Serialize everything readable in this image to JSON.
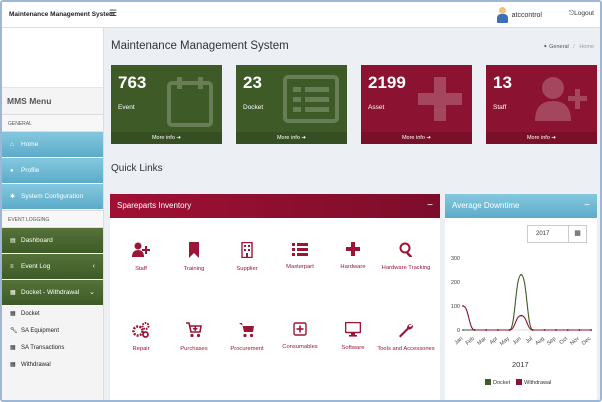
{
  "app": {
    "brand": "Maintenance Management System",
    "user": "atccontrol",
    "logout": "Logout"
  },
  "page": {
    "title": "Maintenance Management System",
    "breadcrumb": [
      "General",
      "Home"
    ]
  },
  "sidebar": {
    "menu_title": "MMS Menu",
    "section_general": "GENERAL",
    "section_event": "EVENT LOGGING",
    "items": [
      {
        "label": "Home",
        "icon": "home-icon"
      },
      {
        "label": "Profile",
        "icon": "user-icon"
      },
      {
        "label": "System Configuration",
        "icon": "gear-icon"
      }
    ],
    "event_items": [
      {
        "label": "Dashboard",
        "icon": "dashboard-icon"
      },
      {
        "label": "Event Log",
        "icon": "list-icon"
      },
      {
        "label": "Docket - Withdrawal",
        "icon": "calendar-icon"
      }
    ],
    "sub_items": [
      {
        "label": "Docket",
        "icon": "calendar-icon"
      },
      {
        "label": "SA Equipment",
        "icon": "wrench-icon"
      },
      {
        "label": "SA Transactions",
        "icon": "calendar-icon"
      },
      {
        "label": "Withdrawal",
        "icon": "calendar-icon"
      }
    ]
  },
  "stats": [
    {
      "value": "763",
      "label": "Event",
      "more": "More info",
      "color": "#3e5a27",
      "icon": "calendar-icon"
    },
    {
      "value": "23",
      "label": "Docket",
      "more": "More info",
      "color": "#3e5a27",
      "icon": "list-icon"
    },
    {
      "value": "2199",
      "label": "Asset",
      "more": "More info",
      "color": "#8b1230",
      "icon": "plus-icon"
    },
    {
      "value": "13",
      "label": "Staff",
      "more": "More info",
      "color": "#8b1230",
      "icon": "user-plus-icon"
    }
  ],
  "quick_links": {
    "title": "Quick Links",
    "panel_title": "Spareparts Inventory",
    "items": [
      {
        "label": "Staff",
        "icon": "user-plus-icon"
      },
      {
        "label": "Training",
        "icon": "bookmark-icon"
      },
      {
        "label": "Supplier",
        "icon": "building-icon"
      },
      {
        "label": "Masterpart",
        "icon": "list-icon"
      },
      {
        "label": "Hardware",
        "icon": "plus-icon"
      },
      {
        "label": "Hardware Tracking",
        "icon": "search-icon"
      },
      {
        "label": "Repair",
        "icon": "gears-icon"
      },
      {
        "label": "Purchases",
        "icon": "cart-plus-icon"
      },
      {
        "label": "Procurement",
        "icon": "cart-icon"
      },
      {
        "label": "Consumables",
        "icon": "plus-square-icon"
      },
      {
        "label": "Software",
        "icon": "monitor-icon"
      },
      {
        "label": "Tools and Accessories",
        "icon": "wrench-icon"
      }
    ]
  },
  "downtime": {
    "title": "Average Downtime",
    "year": "2017",
    "minimize": "−"
  },
  "chart_data": {
    "type": "line",
    "title": "",
    "xlabel": "2017",
    "ylabel": "",
    "categories": [
      "Jan",
      "Feb",
      "Mar",
      "Apr",
      "May",
      "Jun",
      "Jul",
      "Aug",
      "Sep",
      "Oct",
      "Nov",
      "Dec"
    ],
    "ylim": [
      0,
      300
    ],
    "yticks": [
      0,
      100,
      200,
      300
    ],
    "series": [
      {
        "name": "Docket",
        "color": "#3e5a27",
        "values": [
          0,
          0,
          0,
          0,
          0,
          230,
          0,
          0,
          0,
          0,
          0,
          0
        ]
      },
      {
        "name": "Withdrawal",
        "color": "#8b1230",
        "values": [
          100,
          0,
          0,
          0,
          0,
          60,
          0,
          0,
          0,
          0,
          0,
          0
        ]
      }
    ]
  }
}
